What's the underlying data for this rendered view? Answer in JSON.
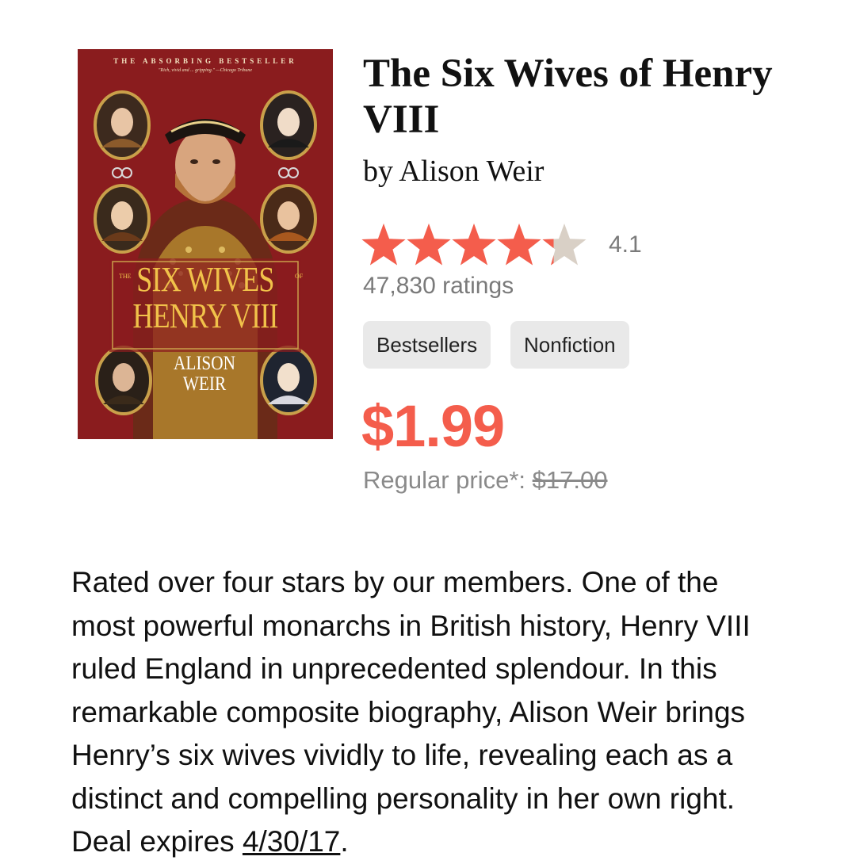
{
  "cover": {
    "tagline": "THE ABSORBING BESTSELLER",
    "quote": "\"Rich, vivid and ... gripping.\" —Chicago Tribune",
    "title_line1": "SIX WIVES",
    "title_line2": "HENRY VIII",
    "title_small_the": "THE",
    "title_small_of": "OF",
    "author_line1": "ALISON",
    "author_line2": "WEIR",
    "colors": {
      "background": "#8a1c1e",
      "title": "#f1c24a",
      "gold": "#c9a04a"
    }
  },
  "book": {
    "title": "The Six Wives of Henry VIII",
    "author_line": "by Alison Weir"
  },
  "rating": {
    "value": "4.1",
    "stars_filled": 4.1,
    "stars_max": 5,
    "count_text": "47,830 ratings",
    "colors": {
      "filled": "#f45d4c",
      "empty": "#d9d0c6"
    }
  },
  "tags": [
    "Bestsellers",
    "Nonfiction"
  ],
  "pricing": {
    "price": "$1.99",
    "regular_label": "Regular price*:",
    "regular_value": "$17.00",
    "accent_color": "#f45d4c"
  },
  "description": {
    "text": "Rated over four stars by our members. One of the most powerful monarchs in British history, Henry VIII ruled England in unprecedented splendour. In this remarkable composite biography, Alison Weir brings Henry’s six wives vividly to life, revealing each as a distinct and compelling personality in her own right. Deal expires",
    "deal_date": "4/30/17",
    "end": "."
  }
}
